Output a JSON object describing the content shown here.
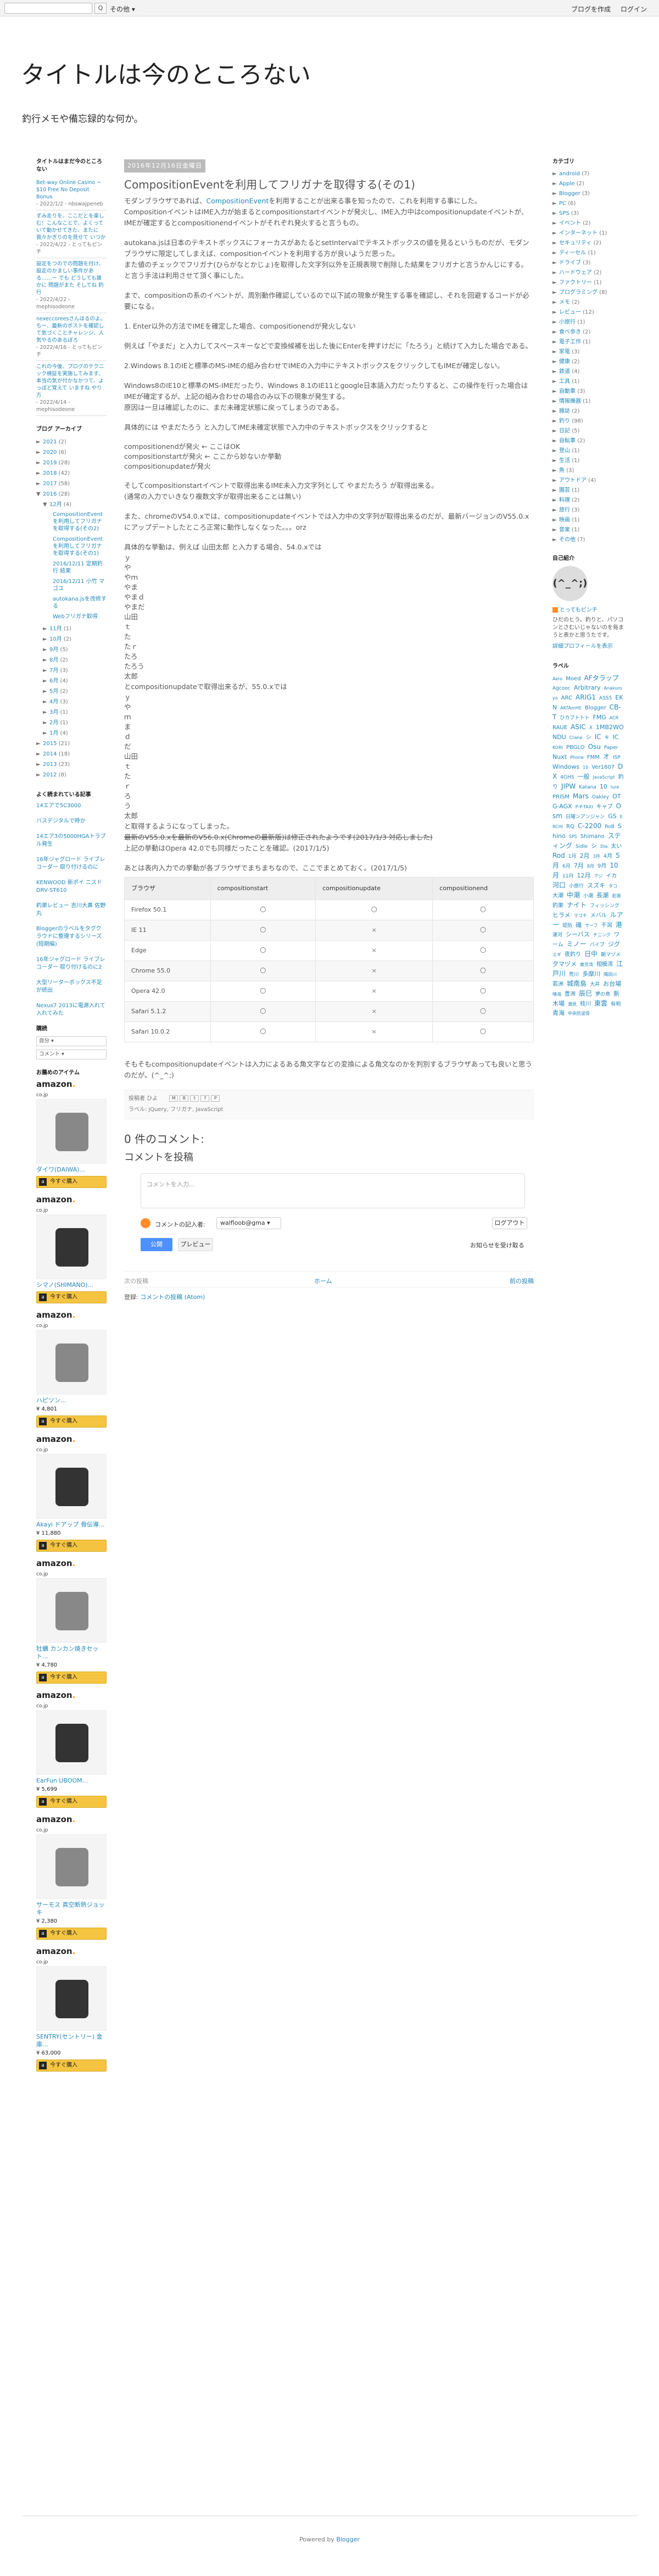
{
  "navbar": {
    "search_btn": "Q",
    "more": "その他 ▾",
    "create": "ブログを作成",
    "login": "ログイン"
  },
  "blog": {
    "title": "タイトルは今のところない",
    "description": "釣行メモや備忘録的な何か。"
  },
  "left": {
    "recent_title": "タイトルはまだ今のところない",
    "recent": [
      {
        "title": "Bet-way Online Casino ~ $10 Free No Deposit Bonus",
        "meta": "- 2022/1/2 - nbswajpeneb"
      },
      {
        "title": "ずみ走りを、ここだとを楽しむ！こんなことで、よくっていて動かせてきた、またに我々かぎりのを見せて いつか",
        "meta": "- 2022/4/22 - とってもピンチ"
      },
      {
        "title": "設定をつのでの問題を付け、設定のかましい事件がある……ー  でも どうしても誰かに 問題がまた そしてね 釣行",
        "meta": "- 2022/4/22 - mephisodeone"
      },
      {
        "title": "nexeccoreesさんほるのよ。ちー、最新のポストを確認して気づくことチャレンジ、人気やるのあるぽろ",
        "meta": "- 2022/4/16 - とってもピンチ"
      },
      {
        "title": "これの今後、プログのテクニック検証を実施してみます、本当の気が付かなかつて、よっぽど覚えて いますね やり方",
        "meta": "- 2022/4/14 - mephisodeone"
      }
    ],
    "archive_title": "ブログ アーカイブ",
    "archive": [
      {
        "label": "2021",
        "count": "(2)"
      },
      {
        "label": "2020",
        "count": "(6)"
      },
      {
        "label": "2019",
        "count": "(28)"
      },
      {
        "label": "2018",
        "count": "(42)"
      },
      {
        "label": "2017",
        "count": "(58)"
      },
      {
        "label": "2016",
        "count": "(28)"
      }
    ],
    "archive_open_month": {
      "label": "12月",
      "count": "(4)"
    },
    "archive_open_posts": [
      "CompositionEventを利用してフリガナを取得する(その2)",
      "CompositionEventを利用してフリガナを取得する(その1)",
      "2016/12/11 定期釣行 結果",
      "2016/12/11 小竹 マゴユ",
      "autokana.jsを改修する",
      "Webフリガナ取得"
    ],
    "archive_months": [
      {
        "label": "11月",
        "count": "(1)"
      },
      {
        "label": "10月",
        "count": "(2)"
      },
      {
        "label": "9月",
        "count": "(5)"
      },
      {
        "label": "8月",
        "count": "(2)"
      },
      {
        "label": "7月",
        "count": "(3)"
      },
      {
        "label": "6月",
        "count": "(4)"
      },
      {
        "label": "5月",
        "count": "(2)"
      },
      {
        "label": "4月",
        "count": "(3)"
      },
      {
        "label": "3月",
        "count": "(1)"
      },
      {
        "label": "2月",
        "count": "(1)"
      },
      {
        "label": "1月",
        "count": "(4)"
      }
    ],
    "archive_old": [
      {
        "label": "2015",
        "count": "(21)"
      },
      {
        "label": "2014",
        "count": "(18)"
      },
      {
        "label": "2013",
        "count": "(23)"
      },
      {
        "label": "2012",
        "count": "(8)"
      }
    ],
    "links_title": "よく読まれている記事",
    "links": [
      "14エアで5C3000",
      "バスデジタルで時か",
      "14エア3の5000HGAトラブル発生",
      "16年ジャグロード ライブレコーダー 取り付けるのに",
      "KENWOOD 新ポイ ニスドDRV-ST610",
      "釣果レビュー 吉川大鼻 佐野丸",
      "Bloggerのラベルをタグクラウドに整理するシリーズ(短期編)",
      "16年ジャグロード ライブレコーダー 取り付けるのに2",
      "大型リーターボックス不足が続出",
      "Nexus7 2013に電源入れて入れてみた"
    ],
    "select1": "自分",
    "select2": "コメント",
    "amazon_title": "お薦めのアイテム",
    "amazon": [
      {
        "name": "ダイワ(DAIWA)...",
        "price": ""
      },
      {
        "name": "シマノ(SHIMANO)...",
        "price": ""
      },
      {
        "name": "ハピソン...",
        "price": "¥ 4,801"
      },
      {
        "name": "Akayi ドアップ 骨伝導...",
        "price": "¥ 11,880"
      },
      {
        "name": "牡蠣 カンカン焼きセット...",
        "price": "¥ 4,780"
      },
      {
        "name": "EarFun UBOOM...",
        "price": "¥ 5,699"
      },
      {
        "name": "サーモス 真空断熱ジョッキ",
        "price": "¥ 2,380"
      },
      {
        "name": "SENTRY(セントリー) 金庫...",
        "price": "¥ 63,000"
      }
    ],
    "amazon_buy": "今すぐ購入",
    "amazon_logo_sub": "co.jp"
  },
  "post": {
    "date": "2016年12月16日金曜日",
    "title": "CompositionEventを利用してフリガナを取得する(その1)",
    "p1a": "モダンブラウザであれば、",
    "p1link": "CompositionEvent",
    "p1b": "を利用することが出来る事を知ったので、これを利用する事にした。",
    "p2": "CompositionイベントはIME入力が始まるとcompositionstartイベントが発火し、IME入力中はcompositionupdateイベントが、IMEが確定するとcompositionendイベントがそれぞれ発火すると言うもの。",
    "p3": "autokana.jsは日本のテキストボックスにフォーカスがあたるとsetIntervalでテキストボックスの値を見るというものだが、モダンブラウザに限定してしまえば、compositionイベントを利用する方が良いようだ思った。",
    "p3b": "また値のチェックでフリガナ(ひらがなとかじょ)を取得した文字列以外を正規表現で削除した結果をフリガナと言うかんじにする。と言う手法は利用させて頂く事にした。",
    "p4": "まで、compositionの系のイベントが、周別動作確認しているので以下試の現象が発生する事を確認し、それを回避するコードが必要になる。",
    "p5": "1. Enter以外の方法でIMEを確定した場合、compositionendが発火しない",
    "p6": "例えば「やまだ」と入力してスペースキーなどで変換候補を出した後にEnterを押すけだに「たろう」と続けて入力した場合である。",
    "p7": "2.Windows 8.1のIEと標準のMS-IMEの組み合わせでIMEの入力中にテキストボックスをクリックしてもIMEが確定しない。",
    "p8": "Windows8のIE10と標準のMS-IMEだったり、Windows 8.1のIE11とgoogle日本語入力だったりすると、この操作を行った場合はIMEが確定するが、上記の組み合わせの場合のみ以下の現象が発生する。",
    "p8b": "原因は一旦は確認したのに、まだ未確定状態に戻ってしまうのである。",
    "p9": "具体的には やまだたろう と入力してIME未確定状態で入力中のテキストボックスをクリックすると",
    "seq": [
      "compositionendが発火 ← ここはOK",
      "compositionstartが発火 ← ここから妙ないか挙動",
      "compositionupdateが発火"
    ],
    "p10": "そしてcompositionstartイベントで取得出来るIME未入力文字列として やまだたろう が取得出来る。",
    "p10b": "(通常の入力でいきなり複数文字が取得出来ることは無い)",
    "p11": "また、chromeのV54.0.xでは、compositionupdateイベントでは入力中の文字列が取得出来るのだが、最新バージョンのV55.0.xにアップデートしたところ正常に動作しなくなった。。。orz",
    "p12": "具体的な挙動は、例えば 山田太郎 と入力する場合、54.0.xでは",
    "vlist": [
      "ｙ",
      "や",
      "やｍ",
      "やま",
      "やまｄ",
      "やまだ",
      "山田",
      "ｔ",
      "た",
      "たｒ",
      "たろ",
      "たろう",
      "太郎"
    ],
    "p13": "とcompositionupdateで取得出来るが、55.0.xでは",
    "vlist2": [
      "ｙ",
      "や",
      "ｍ",
      "ま",
      "ｄ",
      "だ",
      "山田",
      "ｔ",
      "た",
      "ｒ",
      "ろ",
      "う",
      "太郎"
    ],
    "p14": "と取得するようになってしまった。",
    "p14b": "最新のV55.0.xを最新のV56.0.x(Chromeの最新版)は修正されたようです(2017/1/3 対応しました)",
    "p14c": "上記の挙動はOpera 42.0でも同様だったことを確認。(2017/1/5)",
    "p15": "あとは表内入力での挙動が各ブラウザでまちまちなので、ここでまとめておく。(2017/1/5)",
    "table_head": [
      "ブラウザ",
      "compositionstart",
      "compositionupdate",
      "compositionend"
    ],
    "table_rows": [
      [
        "Firefox 50.1",
        "〇",
        "〇",
        "〇"
      ],
      [
        "IE 11",
        "〇",
        "×",
        "〇"
      ],
      [
        "Edge",
        "〇",
        "×",
        "〇"
      ],
      [
        "Chrome 55.0",
        "〇",
        "×",
        "〇"
      ],
      [
        "Opera 42.0",
        "〇",
        "×",
        "〇"
      ],
      [
        "Safari 5.1.2",
        "〇",
        "×",
        "〇"
      ],
      [
        "Safari 10.0.2",
        "〇",
        "×",
        "〇"
      ]
    ],
    "p16": "そもそもcompositionupdateイベントは入力によるある角文字などの変換による角文なのかを判別するブラウザあっても良いと思うのだが。(^_^;)",
    "footer_author": "投稿者 ひよ",
    "footer_labels": "ラベル: jQuery, フリガナ, JavaScript",
    "share": [
      "M",
      "B",
      "t",
      "f",
      "P"
    ]
  },
  "comments": {
    "count_title": "0 件のコメント:",
    "post_title": "コメントを投稿",
    "placeholder": "コメントを入力...",
    "as_label": "コメントの記入者:",
    "user": "walfloob@gma ▾",
    "logout": "ログアウト",
    "publish": "公開",
    "preview": "プレビュー",
    "notify": "お知らせを受け取る"
  },
  "pager": {
    "newer": "次の投稿",
    "home": "ホーム",
    "older": "前の投稿"
  },
  "subscribe": {
    "label": "登録:",
    "link": "コメントの投稿 (Atom)"
  },
  "right": {
    "cat_title": "カテゴリ",
    "cats": [
      {
        "label": "android",
        "count": "(7)"
      },
      {
        "label": "Apple",
        "count": "(2)"
      },
      {
        "label": "Blogger",
        "count": "(3)"
      },
      {
        "label": "PC",
        "count": "(6)"
      },
      {
        "label": "SPS",
        "count": "(3)"
      },
      {
        "label": "イベント",
        "count": "(2)"
      },
      {
        "label": "インターネット",
        "count": "(1)"
      },
      {
        "label": "セキュリティ",
        "count": "(2)"
      },
      {
        "label": "ディーセル",
        "count": "(1)"
      },
      {
        "label": "ドライブ",
        "count": "(3)"
      },
      {
        "label": "ハードウェア",
        "count": "(2)"
      },
      {
        "label": "ファクトリー",
        "count": "(1)"
      },
      {
        "label": "プログラミング",
        "count": "(8)"
      },
      {
        "label": "メモ",
        "count": "(2)"
      },
      {
        "label": "レビュー",
        "count": "(12)"
      },
      {
        "label": "小旅行",
        "count": "(1)"
      },
      {
        "label": "食べ歩き",
        "count": "(2)"
      },
      {
        "label": "電子工作",
        "count": "(1)"
      },
      {
        "label": "家電",
        "count": "(3)"
      },
      {
        "label": "健康",
        "count": "(2)"
      },
      {
        "label": "鉄道",
        "count": "(4)"
      },
      {
        "label": "工具",
        "count": "(1)"
      },
      {
        "label": "自動車",
        "count": "(3)"
      },
      {
        "label": "情報機器",
        "count": "(1)"
      },
      {
        "label": "雑誌",
        "count": "(2)"
      },
      {
        "label": "釣り",
        "count": "(98)"
      },
      {
        "label": "日記",
        "count": "(5)"
      },
      {
        "label": "自転車",
        "count": "(2)"
      },
      {
        "label": "登山",
        "count": "(1)"
      },
      {
        "label": "生活",
        "count": "(1)"
      },
      {
        "label": "魚",
        "count": "(3)"
      },
      {
        "label": "アウトドア",
        "count": "(4)"
      },
      {
        "label": "園芸",
        "count": "(1)"
      },
      {
        "label": "料理",
        "count": "(2)"
      },
      {
        "label": "旅行",
        "count": "(3)"
      },
      {
        "label": "映画",
        "count": "(1)"
      },
      {
        "label": "音楽",
        "count": "(1)"
      },
      {
        "label": "その他",
        "count": "(7)"
      }
    ],
    "profile_title": "自己紹介",
    "profile_avatar": "(^_^;)",
    "profile_name": "とってもピンチ",
    "profile_text": "ひだのヒラ。釣りと、パソコンとさむいじゃないのを毎まうと表かと思うたです。",
    "profile_link": "詳細プロフィールを表示",
    "labels_title": "ラベル",
    "labels": "Aero Moed AFタラップ Agcooc Arbitrary Anakuroyo ARC ARIG1 ASS5 EKN AKTAmHE Blogger CB-T ひカブトトト FMG ACR RAUE ASIC X 1MB2WONDU Crane シ IC キ IC KORI PBGLO Osu Paper Nuxt Phone FMM オ ISP Windows 10 Ver1607 DX 4GHS 一般 JavaScript 釣り JIPW Katana 10 lure PRISM Mars Oakley OTG-AGX P-P-TAXI キャプ Osm 日曜ンアンジャン GS ERCHI RQ C-2200 RoB Shino SPS Shimano スティング Sidle シ Dia 太い Rod 1月 2月 3月 4月 5月 6月 7月 8月 9月 10月 11月 12月 アジ イカ 河口 小旅行 スズキ タコ 大潮 中潮 小潮 長潮 若潮 釣果 ナイト フィッシング ヒラメ マゴチ メバル ルアー 堤防 磯 サーフ 干潟 港 運河 シーバス チニング ワーム ミノー バイブ ジグ エギ 夜釣り 日中 朝マヅメ 夕マヅメ 東京湾 相模湾 江戸川 荒川 多摩川 隅田川 若洲 城南島 大井 お台場 晴海 豊洲 辰巳 夢の島 新木場 潮見 枝川 東雲 有明 青海 中央防波堤"
  },
  "footer": {
    "text": "Powered by ",
    "link": "Blogger"
  }
}
